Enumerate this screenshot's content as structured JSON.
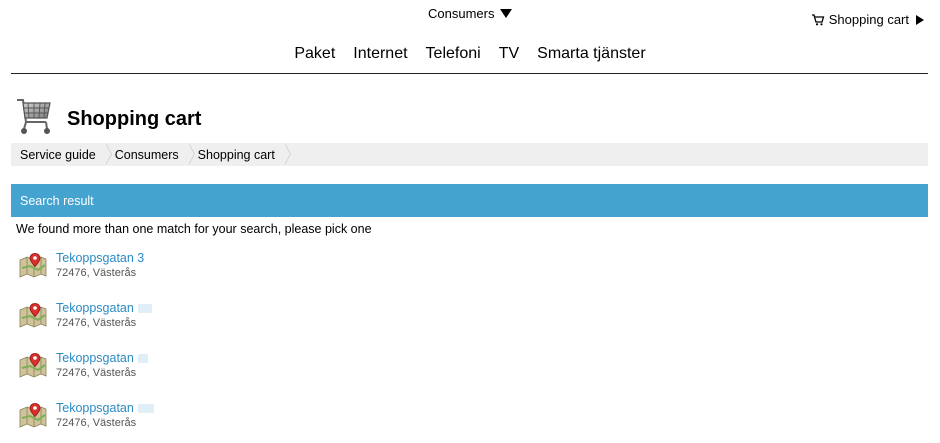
{
  "top": {
    "consumer_label": "Consumers",
    "cart_label": "Shopping cart"
  },
  "nav": {
    "items": [
      "Paket",
      "Internet",
      "Telefoni",
      "TV",
      "Smarta tjänster"
    ]
  },
  "page": {
    "title": "Shopping cart"
  },
  "breadcrumb": [
    "Service guide",
    "Consumers",
    "Shopping cart"
  ],
  "search": {
    "header": "Search result",
    "message": "We found more than one match for your search, please pick one"
  },
  "results": [
    {
      "street": "Tekoppsgatan 3",
      "city": "72476, Västerås"
    },
    {
      "street": "Tekoppsgatan",
      "city": "72476, Västerås"
    },
    {
      "street": "Tekoppsgatan",
      "city": "72476, Västerås"
    },
    {
      "street": "Tekoppsgatan",
      "city": "72476, Västerås"
    }
  ],
  "colors": {
    "accent": "#45a3d0",
    "link": "#2b8bc3",
    "breadcrumb_bg": "#efefef"
  },
  "icons": [
    "chevron-down-icon",
    "cart-icon",
    "chevron-right-icon",
    "shopping-cart-icon",
    "map-pin-icon"
  ]
}
